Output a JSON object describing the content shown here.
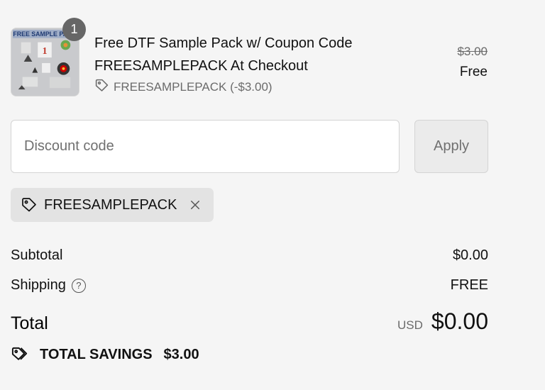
{
  "line_item": {
    "quantity": "1",
    "title": "Free DTF Sample Pack w/ Coupon Code FREESAMPLEPACK At Checkout",
    "discount_applied": "FREESAMPLEPACK (-$3.00)",
    "original_price": "$3.00",
    "final_price": "Free",
    "thumbnail_text": "FREE SAMPLE PACK"
  },
  "discount_form": {
    "placeholder": "Discount code",
    "apply_label": "Apply"
  },
  "applied_code": {
    "code": "FREESAMPLEPACK"
  },
  "summary": {
    "subtotal_label": "Subtotal",
    "subtotal_value": "$0.00",
    "shipping_label": "Shipping",
    "shipping_help_icon": "?",
    "shipping_value": "FREE",
    "total_label": "Total",
    "currency": "USD",
    "total_value": "$0.00",
    "savings_label": "TOTAL SAVINGS",
    "savings_value": "$3.00"
  },
  "colors": {
    "background": "#f5f5f5",
    "badge": "#666666",
    "chip": "#e3e3e3",
    "muted_text": "#6b6b6b"
  },
  "icons": [
    "tag-icon",
    "close-icon",
    "help-circle-icon",
    "tags-icon"
  ]
}
